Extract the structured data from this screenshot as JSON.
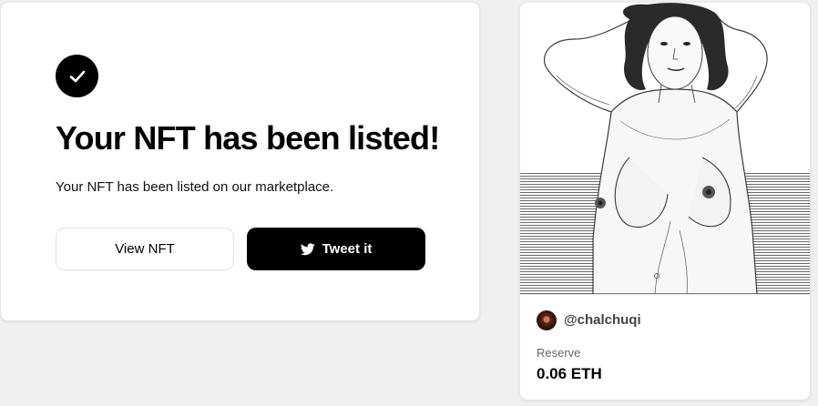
{
  "listing": {
    "title": "Your NFT has been listed!",
    "description": "Your NFT has been listed on our marketplace.",
    "icon": "checkmark-icon",
    "view_button_label": "View NFT",
    "tweet_button_label": "Tweet it",
    "tweet_icon": "twitter-icon"
  },
  "nft": {
    "artwork": "pencil sketch of a nude woman with curly hair against a horizontal-hatched backdrop",
    "creator_handle": "@chalchuqi",
    "reserve_label": "Reserve",
    "reserve_value": "0.06 ETH"
  },
  "colors": {
    "background": "#f0f0f0",
    "card": "#ffffff",
    "primary_button": "#000000",
    "text": "#000000"
  }
}
